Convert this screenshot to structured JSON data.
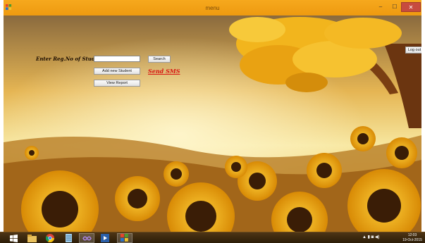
{
  "window": {
    "title": "menu",
    "controls": {
      "minimize": "–",
      "maximize": "☐",
      "close": "✕"
    }
  },
  "form": {
    "reg_label": "Enter Reg.No of Student",
    "reg_value": "",
    "search_label": "Search",
    "add_student_label": "Add new Student",
    "send_sms_label": "Send SMS",
    "view_report_label": "View Report",
    "logout_label": "Log out",
    "sms_color": "#d81a14"
  },
  "taskbar": {
    "apps": [
      {
        "icon": "windows-start-icon"
      },
      {
        "icon": "file-explorer-icon"
      },
      {
        "icon": "chrome-icon"
      },
      {
        "icon": "notepad-icon"
      },
      {
        "icon": "visual-studio-icon"
      },
      {
        "icon": "media-player-icon"
      },
      {
        "icon": "app-window-icon"
      }
    ],
    "tray_icons": "▲ ▮ ◙ ◀)",
    "clock_time": "12:03",
    "clock_date": "19-Oct-2015"
  }
}
